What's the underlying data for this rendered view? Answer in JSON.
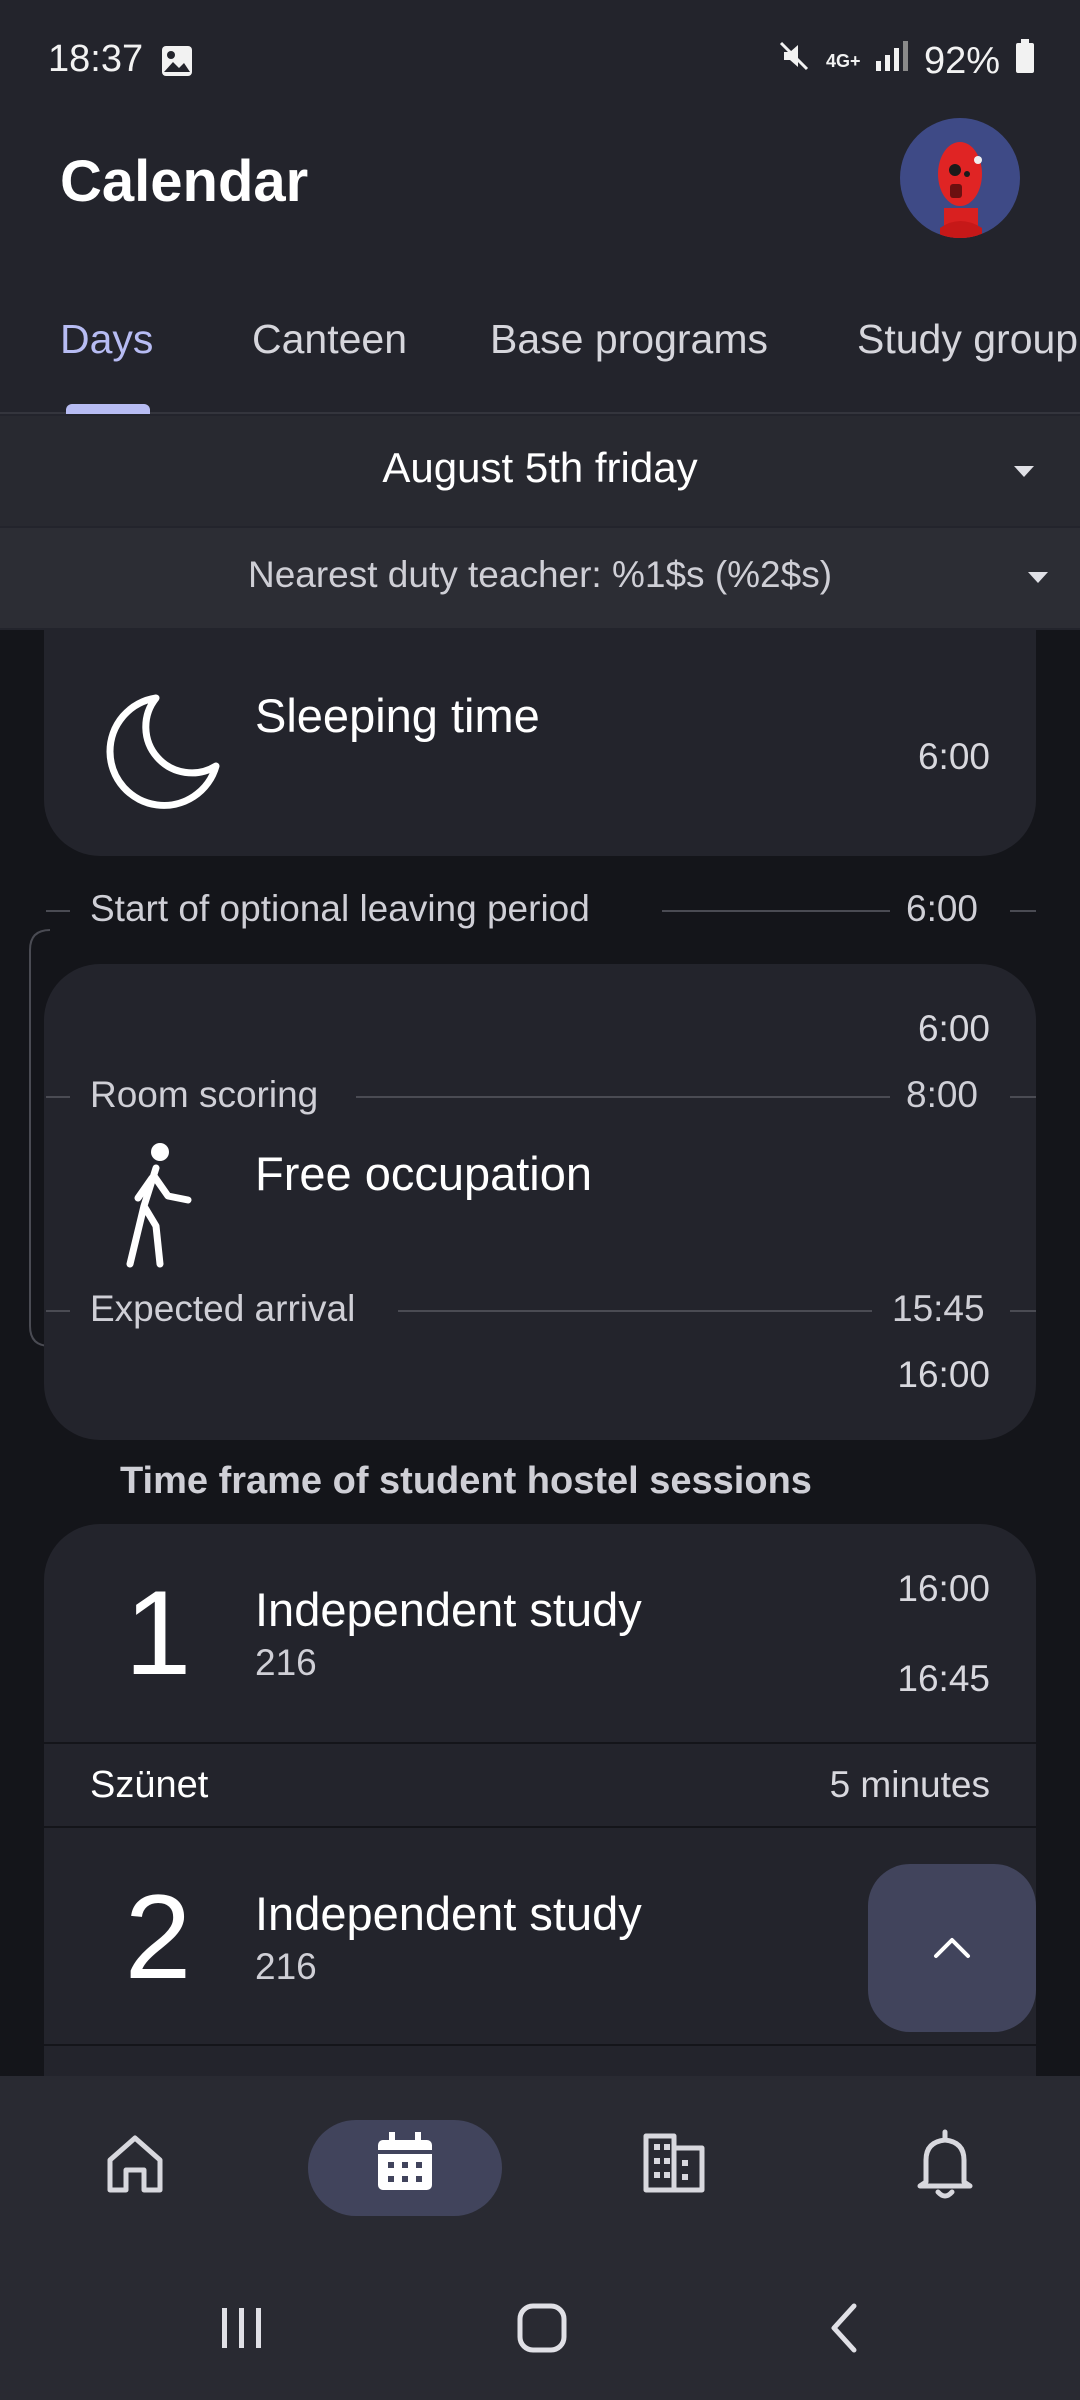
{
  "status_bar": {
    "time": "18:37",
    "network": "4G+",
    "battery": "92%",
    "icons": [
      "gallery-icon",
      "mute-icon",
      "signal-icon",
      "battery-icon"
    ]
  },
  "header": {
    "title": "Calendar"
  },
  "tabs": [
    {
      "label": "Days",
      "active": true
    },
    {
      "label": "Canteen",
      "active": false
    },
    {
      "label": "Base programs",
      "active": false
    },
    {
      "label": "Study group",
      "active": false
    }
  ],
  "date_selector": {
    "label": "August 5th friday"
  },
  "duty_selector": {
    "label": "Nearest duty teacher: %1$s (%2$s)"
  },
  "schedule": {
    "sleeping": {
      "title": "Sleeping time",
      "time": "6:00"
    },
    "optional_leaving": {
      "label": "Start of optional leaving period",
      "time": "6:00"
    },
    "free_occupation": {
      "title": "Free occupation",
      "start": "6:00",
      "end": "16:00",
      "markers": [
        {
          "label": "Room scoring",
          "time": "8:00"
        },
        {
          "label": "Expected arrival",
          "time": "15:45"
        }
      ]
    },
    "section_title": "Time frame of student hostel sessions",
    "sessions": [
      {
        "number": "1",
        "title": "Independent study",
        "room": "216",
        "start": "16:00",
        "end": "16:45"
      },
      {
        "number": "2",
        "title": "Independent study",
        "room": "216"
      }
    ],
    "break": {
      "label": "Szünet",
      "duration": "5 minutes"
    }
  },
  "colors": {
    "background": "#23242c",
    "content_bg": "#14151a",
    "accent": "#b7bcf3",
    "pill": "#41445c"
  },
  "bottom_nav": [
    {
      "icon": "home-icon",
      "active": false
    },
    {
      "icon": "calendar-icon",
      "active": true
    },
    {
      "icon": "building-icon",
      "active": false
    },
    {
      "icon": "bell-icon",
      "active": false
    }
  ]
}
